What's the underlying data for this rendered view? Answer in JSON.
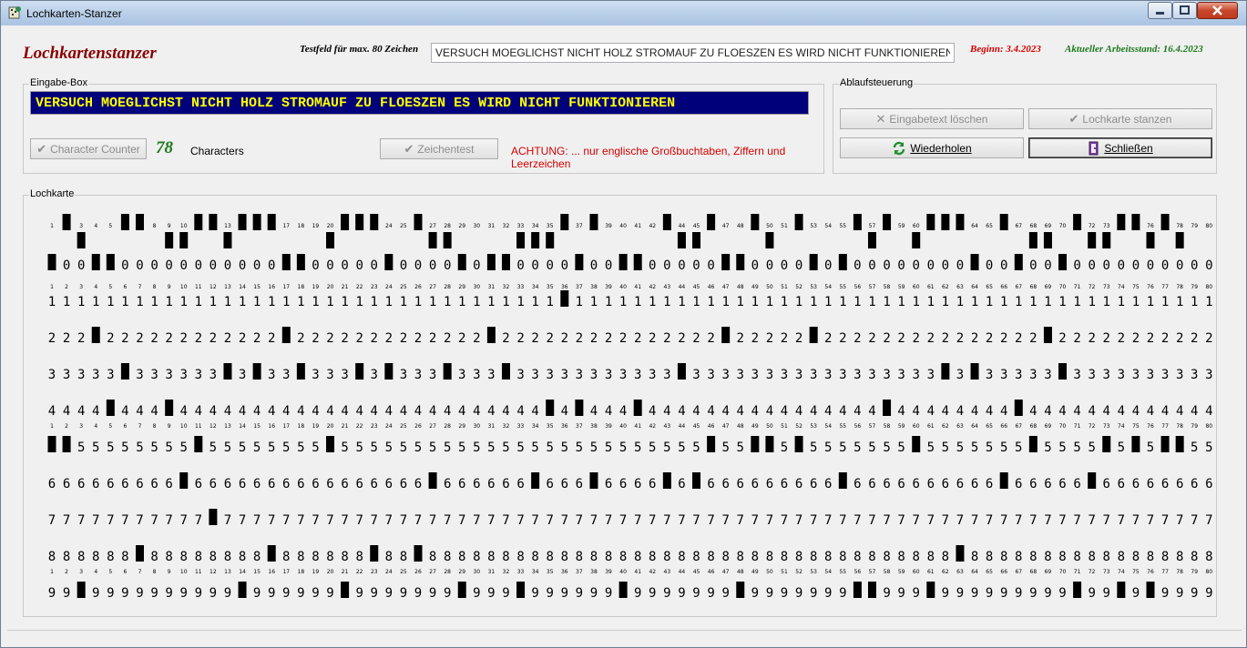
{
  "window": {
    "title": "Lochkarten-Stanzer"
  },
  "header": {
    "title": "Lochkartenstanzer",
    "testfeld_label": "Testfeld für max. 80 Zeichen",
    "testfeld_value": "VERSUCH MOEGLICHST NICHT HOLZ STROMAUF ZU FLOESZEN ES WIRD NICHT FUNKTIONIEREN",
    "beginn": "Beginn: 3.4.2023",
    "arbeitsstand": "Aktueller Arbeitsstand: 16.4.2023"
  },
  "eingabe": {
    "label": "Eingabe-Box",
    "text": "VERSUCH MOEGLICHST NICHT HOLZ STROMAUF ZU FLOESZEN ES WIRD NICHT FUNKTIONIEREN",
    "counter_button": "Character Counter",
    "count": "78",
    "count_label": "Characters",
    "zeichentest_button": "Zeichentest",
    "warning": "ACHTUNG: ... nur englische Großbuchtaben, Ziffern und Leerzeichen"
  },
  "ablauf": {
    "label": "Ablaufsteuerung",
    "loeschen_button": "Eingabetext löschen",
    "stanzen_button": "Lochkarte stanzen",
    "wiederholen_button": "Wiederholen",
    "schliessen_button": "Schließen"
  },
  "lochkarte": {
    "label": "Lochkarte",
    "columns": 80,
    "rows": [
      "12",
      "11",
      "0",
      "1",
      "2",
      "3",
      "4",
      "5",
      "6",
      "7",
      "8",
      "9"
    ],
    "card_text": "VERSUCH MOEGLICHST NICHT HOLZ STROMAUF ZU FLOESZEN ES WIRD NICHT FUNKTIONIEREN"
  },
  "colors": {
    "title": "#8b0000",
    "input_background": "#00007b",
    "input_text": "#ffff00",
    "count": "#1e7a1e",
    "warning": "#d40000",
    "beginn": "#d40000",
    "stand": "#1e7a1e"
  },
  "icons": {
    "app": "punch-card-app-icon",
    "check": "checkmark-icon",
    "delete": "x-icon",
    "repeat": "refresh-icon",
    "close": "door-exit-icon"
  }
}
